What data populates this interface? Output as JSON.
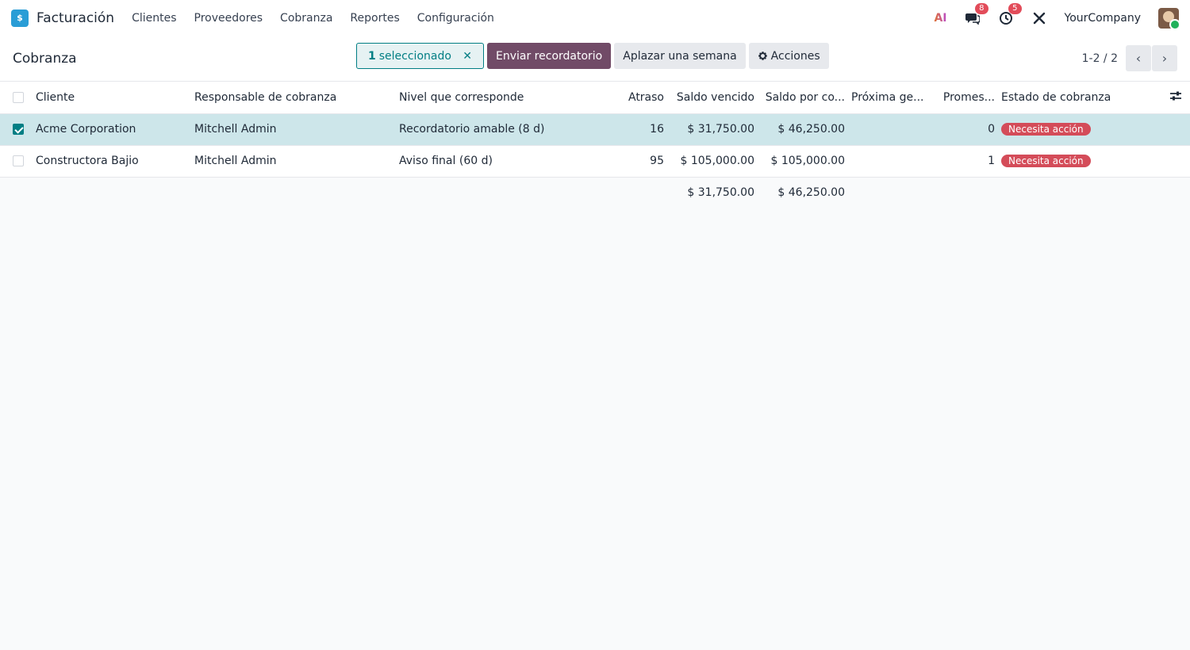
{
  "navbar": {
    "app_name": "Facturación",
    "logo_glyph": "$",
    "menu": [
      "Clientes",
      "Proveedores",
      "Cobranza",
      "Reportes",
      "Configuración"
    ],
    "ai_label": "AI",
    "messages_count": "8",
    "activities_count": "5",
    "company": "YourCompany"
  },
  "control": {
    "title": "Cobranza",
    "selected_count": "1",
    "selected_label": "seleccionado",
    "send_reminder": "Enviar recordatorio",
    "postpone": "Aplazar una semana",
    "actions": "Acciones",
    "pager": "1-2 / 2"
  },
  "table": {
    "headers": [
      "Cliente",
      "Responsable de cobranza",
      "Nivel que corresponde",
      "Atraso",
      "Saldo vencido",
      "Saldo por co...",
      "Próxima ge...",
      "Promes...",
      "Estado de cobranza"
    ],
    "rows": [
      {
        "cliente": "Acme Corporation",
        "responsable": "Mitchell Admin",
        "nivel": "Recordatorio amable (8 d)",
        "atraso": "16",
        "saldo_vencido": "$ 31,750.00",
        "saldo_por_cobrar": "$ 46,250.00",
        "proxima": "",
        "promesas": "0",
        "estado": "Necesita acción",
        "selected": true
      },
      {
        "cliente": "Constructora Bajio",
        "responsable": "Mitchell Admin",
        "nivel": "Aviso final (60 d)",
        "atraso": "95",
        "saldo_vencido": "$ 105,000.00",
        "saldo_por_cobrar": "$ 105,000.00",
        "proxima": "",
        "promesas": "1",
        "estado": "Necesita acción",
        "selected": false
      }
    ],
    "totals": {
      "saldo_vencido": "$ 31,750.00",
      "saldo_por_cobrar": "$ 46,250.00"
    }
  },
  "colors": {
    "accent": "#017e84",
    "primary": "#714b67",
    "status_danger": "#d44c59",
    "selected_row": "#cde6ea"
  }
}
